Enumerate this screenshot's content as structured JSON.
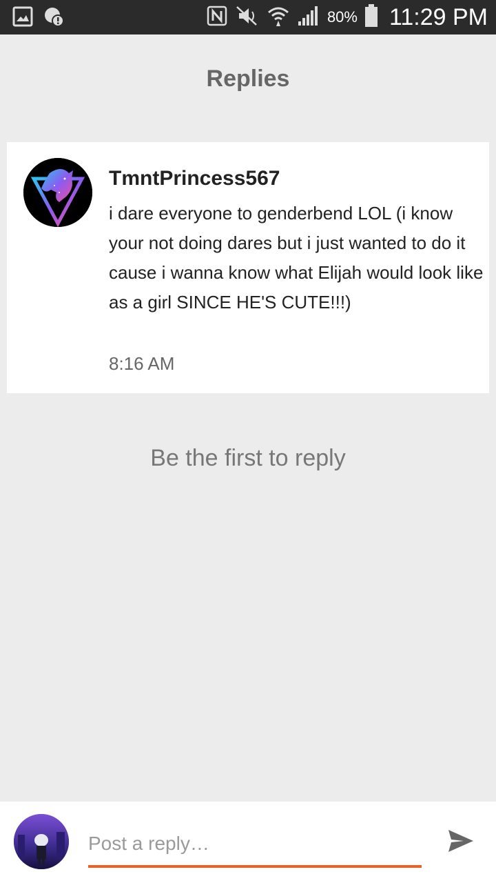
{
  "status_bar": {
    "battery_percent": "80%",
    "time": "11:29 PM",
    "icons": [
      "gallery-icon",
      "alert-icon",
      "nfc-icon",
      "mute-icon",
      "wifi-icon",
      "signal-icon",
      "battery-icon"
    ]
  },
  "header": {
    "title": "Replies"
  },
  "comment": {
    "username": "TmntPrincess567",
    "text": "i dare everyone to genderbend LOL (i know your not doing dares but i just wanted to do it cause i wanna know what Elijah would look like as a girl SINCE HE'S CUTE!!!)",
    "time": "8:16 AM"
  },
  "empty_state": {
    "text": "Be the first to reply"
  },
  "composer": {
    "placeholder": "Post a reply…",
    "send_icon": "send-icon"
  },
  "colors": {
    "accent": "#e8632b",
    "background": "#ececec",
    "status_bar": "#2b2b2b"
  }
}
